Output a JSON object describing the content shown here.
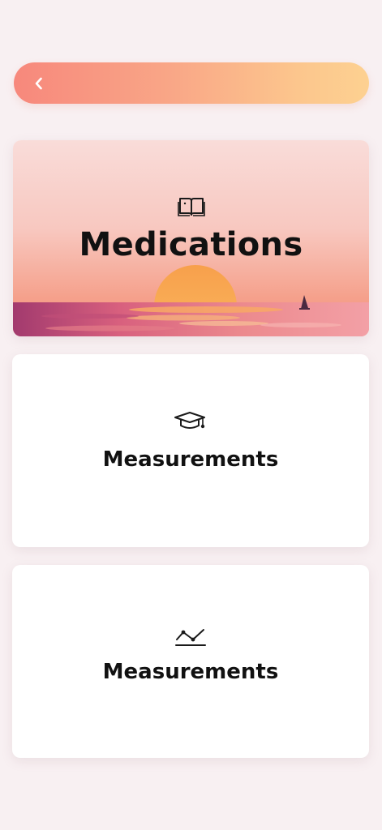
{
  "header": {
    "back_icon": "chevron-left-icon"
  },
  "cards": [
    {
      "title": "Medications",
      "icon": "open-book-icon"
    },
    {
      "title": "Measurements",
      "icon": "graduation-cap-icon"
    },
    {
      "title": "Measurements",
      "icon": "line-chart-icon"
    }
  ],
  "colors": {
    "header_gradient_start": "#f7887c",
    "header_gradient_end": "#fdd191",
    "background": "#f8f0f2",
    "card_background": "#ffffff",
    "text": "#111111"
  }
}
